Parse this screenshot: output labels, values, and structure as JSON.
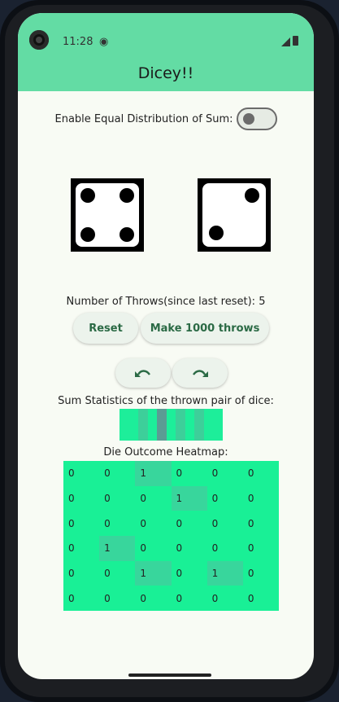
{
  "status": {
    "time": "11:28"
  },
  "app": {
    "title": "Dicey!!"
  },
  "toggle": {
    "label": "Enable Equal Distribution of Sum:",
    "checked": false
  },
  "dice": [
    {
      "name": "left",
      "value": 4
    },
    {
      "name": "right",
      "value": 2
    }
  ],
  "throws": {
    "label": "Number of Throws(since last reset): 5"
  },
  "buttons": {
    "reset": "Reset",
    "make_throws": "Make 1000 throws"
  },
  "sum_stats": {
    "title": "Sum Statistics of the thrown pair of dice:",
    "colors": [
      "#1dee9a",
      "#1dee9a",
      "#3dcf9a",
      "#1dee9a",
      "#5b9c94",
      "#1dee9a",
      "#3dcf9a",
      "#1dee9a",
      "#3dcf9a",
      "#1dee9a",
      "#1dee9a"
    ]
  },
  "heatmap": {
    "title": "Die Outcome Heatmap:",
    "rows": [
      [
        "0",
        "0",
        "1",
        "0",
        "0",
        "0"
      ],
      [
        "0",
        "0",
        "0",
        "1",
        "0",
        "0"
      ],
      [
        "0",
        "0",
        "0",
        "0",
        "0",
        "0"
      ],
      [
        "0",
        "1",
        "0",
        "0",
        "0",
        "0"
      ],
      [
        "0",
        "0",
        "1",
        "0",
        "1",
        "0"
      ],
      [
        "0",
        "0",
        "0",
        "0",
        "0",
        "0"
      ]
    ],
    "zero_color": "#19f096",
    "one_color": "#38d69c"
  },
  "colors": {
    "accent": "#63dca4",
    "button_text": "#2b6a45"
  }
}
